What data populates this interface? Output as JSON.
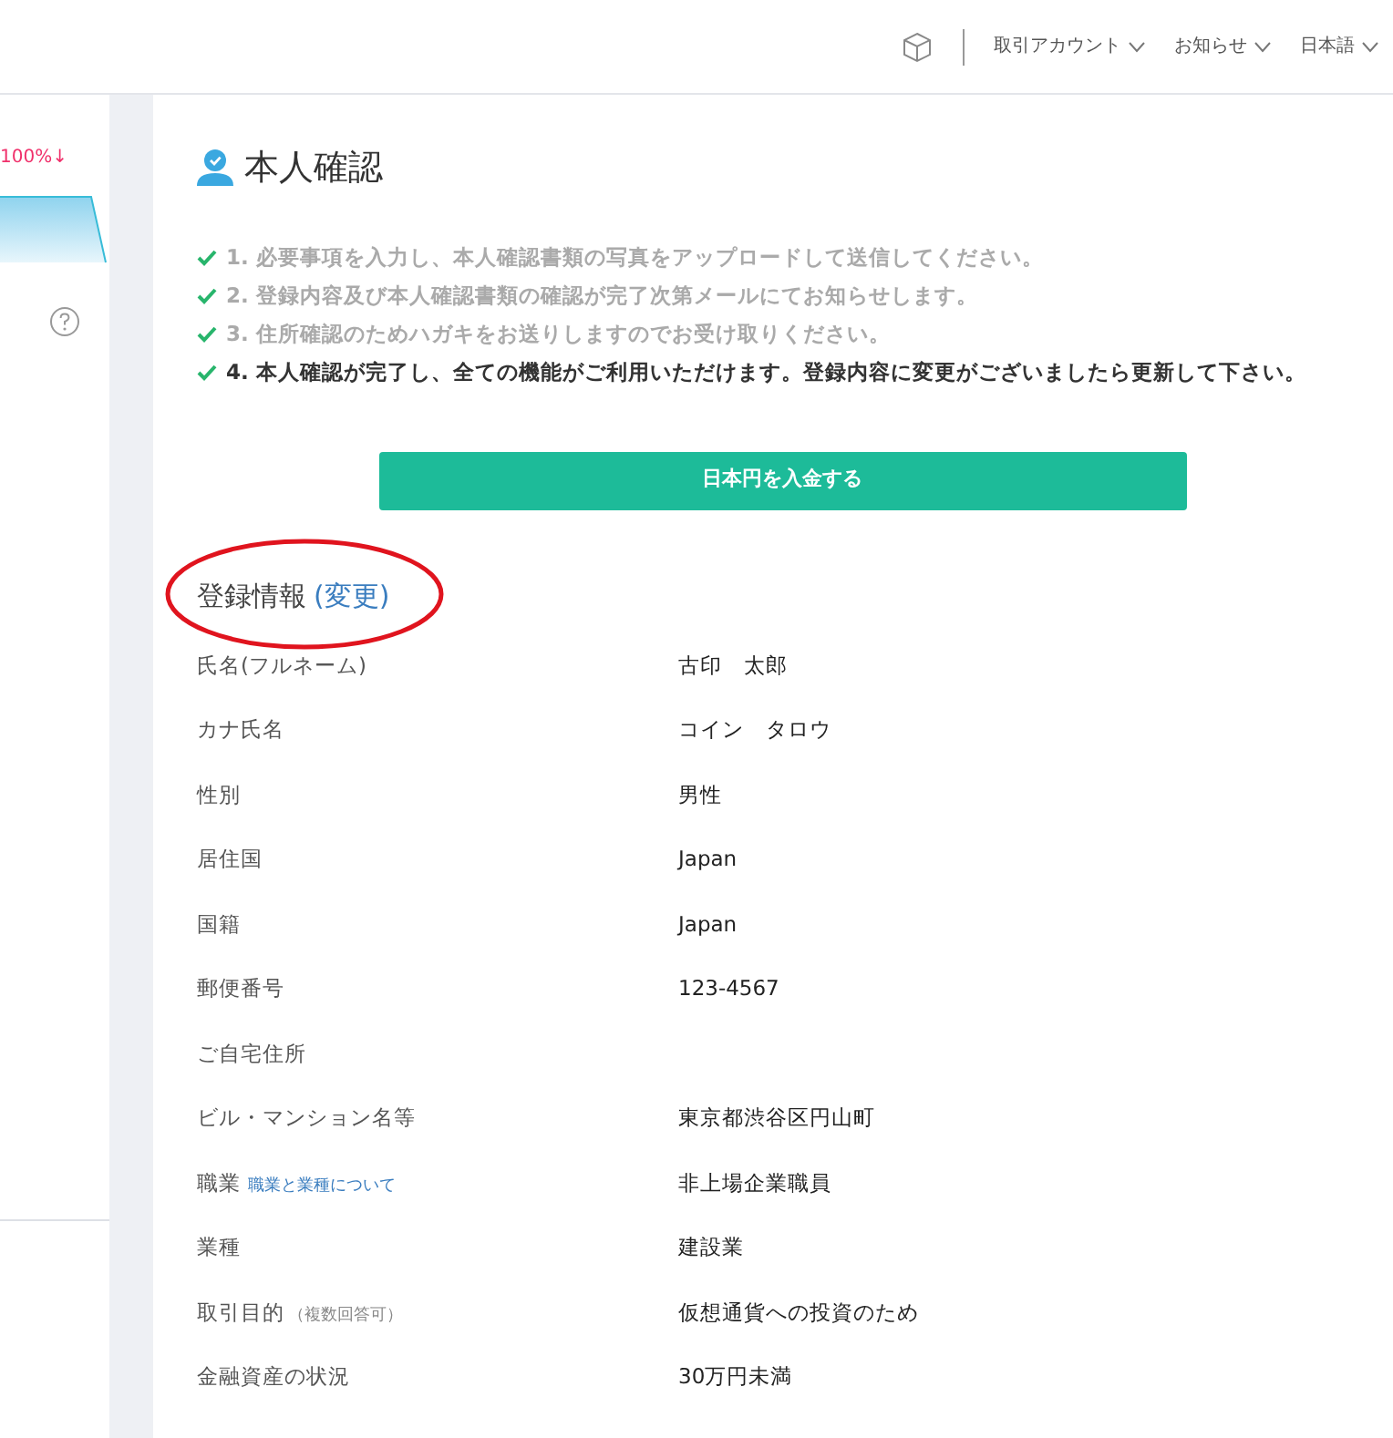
{
  "header": {
    "menus": [
      {
        "label": "取引アカウント"
      },
      {
        "label": "お知らせ"
      },
      {
        "label": "日本語"
      }
    ]
  },
  "left_panel": {
    "change": "100%↓"
  },
  "page_title": "本人確認",
  "steps": [
    {
      "text": "1. 必要事項を入力し、本人確認書類の写真をアップロードして送信してください。",
      "current": false
    },
    {
      "text": "2. 登録内容及び本人確認書類の確認が完了次第メールにてお知らせします。",
      "current": false
    },
    {
      "text": "3. 住所確認のためハガキをお送りしますのでお受け取りください。",
      "current": false
    },
    {
      "text": "4. 本人確認が完了し、全ての機能がご利用いただけます。登録内容に変更がございましたら更新して下さい。",
      "current": true
    }
  ],
  "deposit_button": "日本円を入金する",
  "section": {
    "title": "登録情報",
    "edit_link": "(変更)",
    "circled": true
  },
  "fields": [
    {
      "label": "氏名(フルネーム)",
      "value": "古印　太郎"
    },
    {
      "label": "カナ氏名",
      "value": "コイン　タロウ"
    },
    {
      "label": "性別",
      "value": "男性"
    },
    {
      "label": "居住国",
      "value": "Japan"
    },
    {
      "label": "国籍",
      "value": "Japan"
    },
    {
      "label": "郵便番号",
      "value": "123-4567"
    },
    {
      "label": "ご自宅住所"
    },
    {
      "label": "ビル・マンション名等",
      "value": "東京都渋谷区円山町"
    },
    {
      "label": "職業",
      "note": {
        "kind": "link",
        "text": "職業と業種について"
      },
      "value": "非上場企業職員"
    },
    {
      "label": "業種",
      "value": "建設業"
    },
    {
      "label": "取引目的",
      "note": {
        "kind": "hint",
        "text": "（複数回答可）"
      },
      "value": "仮想通貨への投資のため"
    },
    {
      "label": "金融資産の状況",
      "value": "30万円未満"
    }
  ]
}
